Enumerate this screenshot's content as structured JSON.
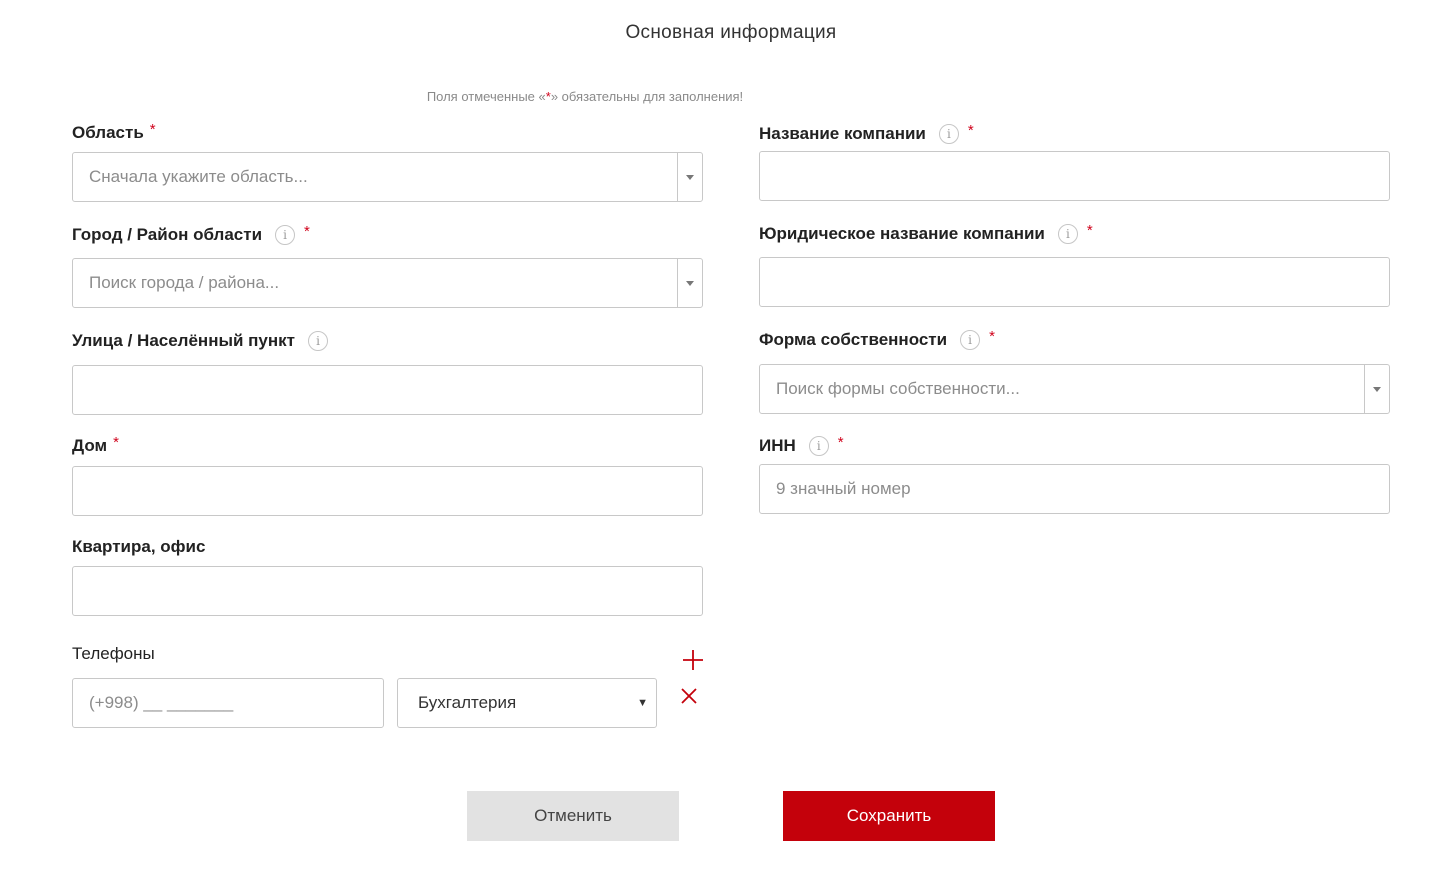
{
  "section_title": "Основная информация",
  "required_note": {
    "prefix": "Поля отмеченные «",
    "star": "*",
    "suffix": "» обязательны для заполнения!"
  },
  "required_mark": "*",
  "info_icon_glyph": "i",
  "left_column": {
    "region": {
      "label": "Область",
      "placeholder": "Сначала укажите область..."
    },
    "city": {
      "label": "Город / Район области",
      "placeholder": "Поиск города / района..."
    },
    "street": {
      "label": "Улица / Населённый пункт",
      "value": ""
    },
    "house": {
      "label": "Дом",
      "value": ""
    },
    "apartment": {
      "label": "Квартира, офис",
      "value": ""
    },
    "phones": {
      "label": "Телефоны",
      "phone_placeholder": "(+998) __ _______",
      "department_selected": "Бухгалтерия",
      "add_icon": "plus-icon",
      "remove_icon": "close-icon"
    }
  },
  "right_column": {
    "company_name": {
      "label": "Название компании",
      "value": ""
    },
    "legal_name": {
      "label": "Юридическое название компании",
      "value": ""
    },
    "ownership_form": {
      "label": "Форма собственности",
      "placeholder": "Поиск формы собственности..."
    },
    "inn": {
      "label": "ИНН",
      "placeholder": "9 значный номер"
    }
  },
  "buttons": {
    "cancel": "Отменить",
    "save": "Сохранить"
  },
  "colors": {
    "accent": "#c4010b",
    "required": "#d0021b",
    "cancel_bg": "#e2e2e2",
    "border": "#c8c8c8"
  }
}
